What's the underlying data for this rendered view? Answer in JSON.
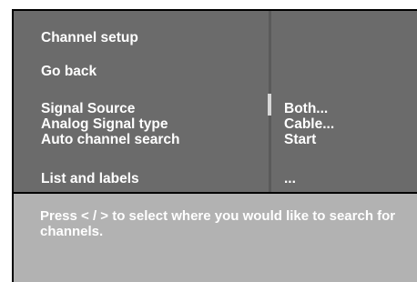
{
  "menu": {
    "title": "Channel setup",
    "back": "Go back",
    "items": [
      {
        "label": "Signal Source",
        "value": "Both..."
      },
      {
        "label": "Analog Signal type",
        "value": "Cable..."
      },
      {
        "label": "Auto channel search",
        "value": "Start"
      },
      {
        "label": "List and labels",
        "value": "..."
      }
    ]
  },
  "help": {
    "text": "Press < / > to select where you would like to search for channels."
  },
  "colors": {
    "panel": "#6b6b6b",
    "help_panel": "#b2b2b2",
    "text": "#ffffff",
    "frame": "#000000"
  }
}
